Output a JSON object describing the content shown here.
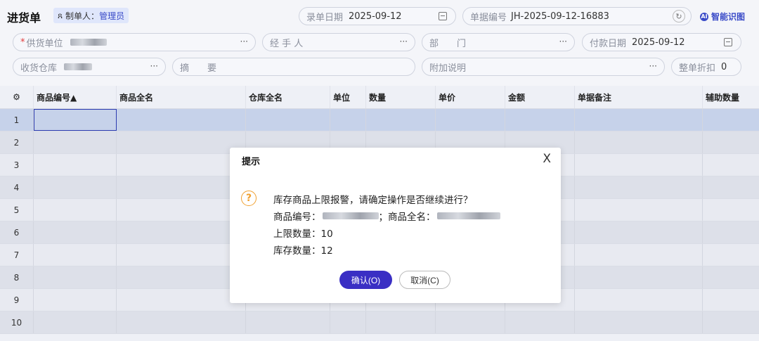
{
  "header": {
    "title": "进货单",
    "maker_label": "制单人：",
    "maker_value": "管理员",
    "entry_date_label": "录单日期",
    "entry_date_value": "2025-09-12",
    "doc_no_label": "单据编号",
    "doc_no_value": "JH-2025-09-12-16883",
    "ai_label": "智能识图"
  },
  "form": {
    "supplier_label": "供货单位",
    "handler_label": "经 手 人",
    "department_label": "部　　门",
    "payment_date_label": "付款日期",
    "payment_date_value": "2025-09-12",
    "warehouse_label": "收货仓库",
    "summary_label": "摘　　要",
    "note_label": "附加说明",
    "discount_label": "整单折扣",
    "discount_value": "0",
    "more_glyph": "···"
  },
  "table": {
    "columns": [
      "商品编号▲",
      "商品全名",
      "仓库全名",
      "单位",
      "数量",
      "单价",
      "金额",
      "单据备注",
      "辅助数量"
    ],
    "rows": [
      "1",
      "2",
      "3",
      "4",
      "5",
      "6",
      "7",
      "8",
      "9",
      "10"
    ]
  },
  "dialog": {
    "title": "提示",
    "close": "X",
    "message": "库存商品上限报警，请确定操作是否继续进行？",
    "product_code_label": "商品编号：",
    "product_name_label": "；商品全名：",
    "upper_limit": "上限数量：10",
    "stock_qty": "库存数量：12",
    "confirm": "确认(O)",
    "cancel": "取消(C)"
  },
  "colors": {
    "accent": "#3a2fc4",
    "warning": "#f0a030",
    "required": "#e23b3b"
  }
}
